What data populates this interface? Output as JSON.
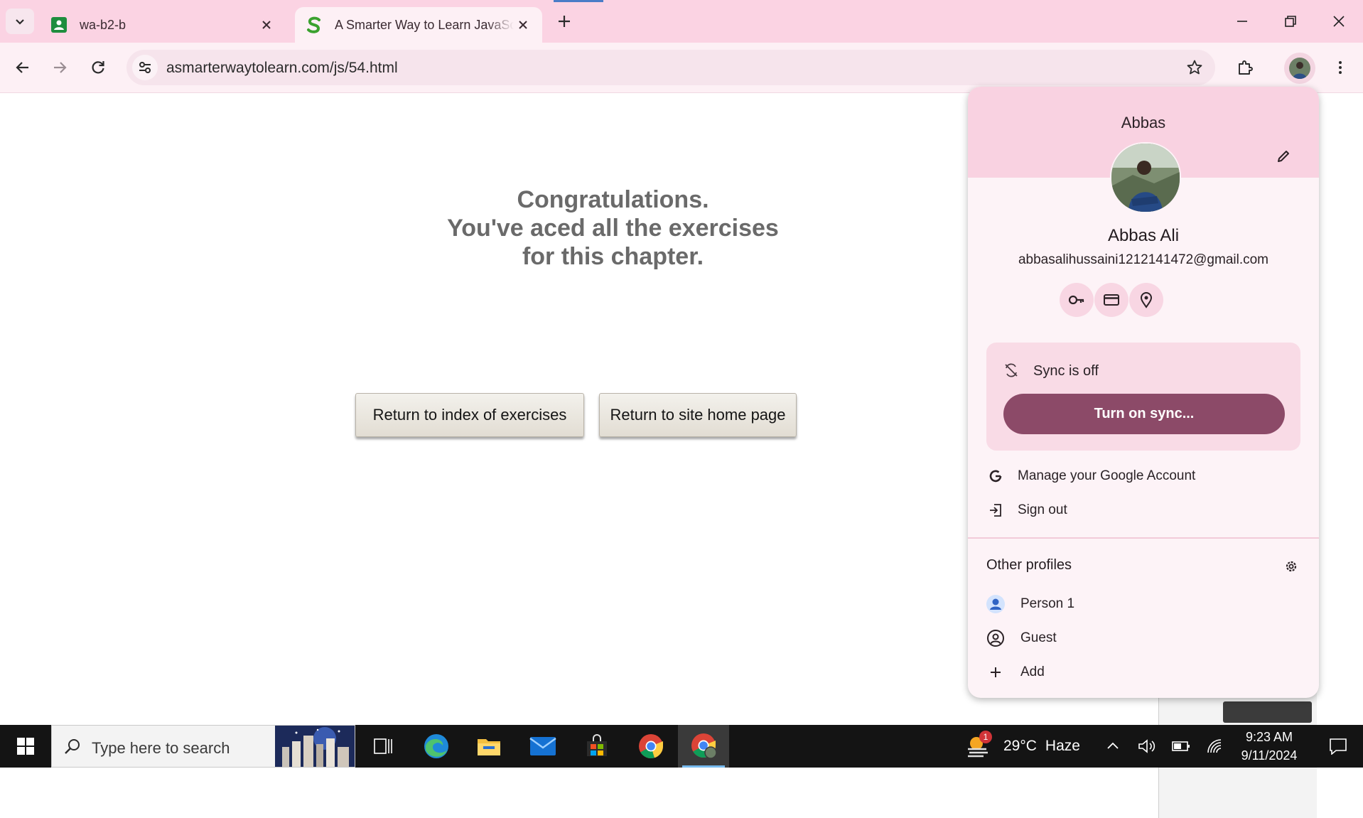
{
  "browser": {
    "tabs": [
      {
        "title": "wa-b2-b",
        "favicon": "green-person-icon"
      },
      {
        "title": "A Smarter Way to Learn JavaScript",
        "favicon": "green-s-logo",
        "active": true
      }
    ],
    "url": "asmarterwaytolearn.com/js/54.html"
  },
  "page": {
    "message": [
      "Congratulations.",
      "You've aced all the exercises",
      "for this chapter."
    ],
    "buttons": [
      "Return to index of exercises",
      "Return to site home page"
    ]
  },
  "profile_menu": {
    "profile_name": "Abbas",
    "full_name": "Abbas Ali",
    "email": "abbasalihussaini1212141472@gmail.com",
    "quick_actions": [
      "key-icon",
      "credit-card-icon",
      "location-pin-icon"
    ],
    "sync_status": "Sync is off",
    "sync_button": "Turn on sync...",
    "manage_account": "Manage your Google Account",
    "sign_out": "Sign out",
    "other_profiles_title": "Other profiles",
    "other_profiles": [
      "Person 1",
      "Guest"
    ],
    "add_label": "Add",
    "accent_color": "#8c4a68"
  },
  "taskbar": {
    "search_placeholder": "Type here to search",
    "weather": {
      "temp": "29°C",
      "condition": "Haze",
      "alerts": "1"
    },
    "time": "9:23 AM",
    "date": "9/11/2024"
  }
}
